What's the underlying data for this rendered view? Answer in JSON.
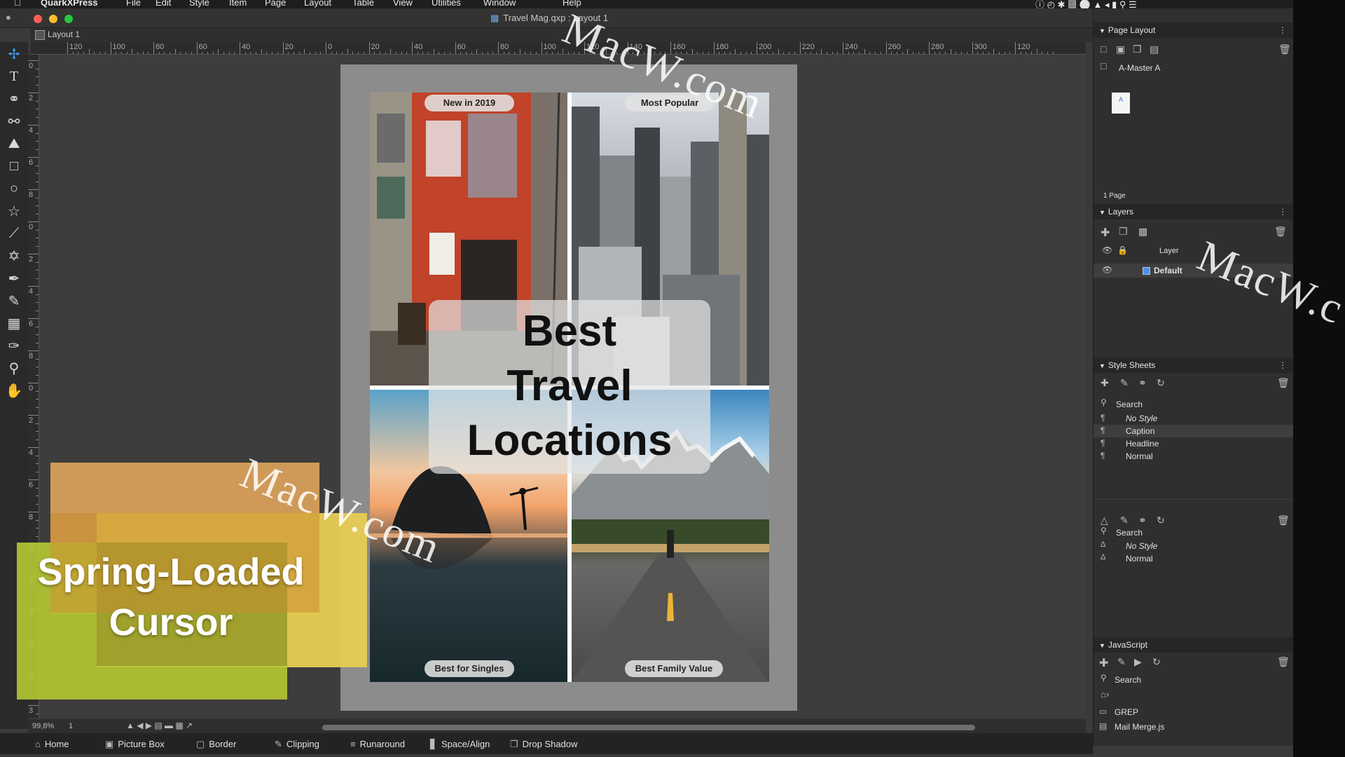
{
  "menubar": {
    "apple_icon": "apple-icon",
    "app_name": "QuarkXPress",
    "items": [
      "File",
      "Edit",
      "Style",
      "Item",
      "Page",
      "Layout",
      "Table",
      "View",
      "Utilities",
      "Window",
      "Help"
    ]
  },
  "window": {
    "title": "Travel Mag.qxp : Layout 1",
    "tab": "Layout 1"
  },
  "rulers": {
    "h": [
      "120",
      "100",
      "80",
      "60",
      "40",
      "20",
      "0",
      "20",
      "40",
      "60",
      "80",
      "100",
      "120",
      "140",
      "160",
      "180",
      "200",
      "220",
      "240",
      "260",
      "280",
      "300",
      "120"
    ],
    "v": [
      "0",
      "2",
      "4",
      "6",
      "8",
      "0",
      "2",
      "4",
      "6",
      "8",
      "0",
      "2",
      "4",
      "6",
      "8",
      "0",
      "2",
      "4",
      "6",
      "8",
      "3"
    ]
  },
  "tools": [
    "move-icon",
    "text-icon",
    "link-icon",
    "unlink-icon",
    "picture-icon",
    "rectangle-icon",
    "oval-icon",
    "star-icon",
    "line-icon",
    "bezier-icon",
    "pen-icon",
    "pencil-icon",
    "table-icon",
    "eyedropper-icon",
    "zoom-icon",
    "hand-icon"
  ],
  "layout": {
    "labels": {
      "top_left": "New in 2019",
      "top_right": "Most Popular",
      "bottom_left": "Best for Singles",
      "bottom_right": "Best Family Value"
    },
    "headline": [
      "Best",
      "Travel",
      "Locations"
    ]
  },
  "status": {
    "zoom": "99,8%",
    "page": "1"
  },
  "bottom_tabs": [
    {
      "label": "Home",
      "icon": "home-icon"
    },
    {
      "label": "Picture Box",
      "icon": "picture-box-icon"
    },
    {
      "label": "Border",
      "icon": "border-icon"
    },
    {
      "label": "Clipping",
      "icon": "clipping-icon"
    },
    {
      "label": "Runaround",
      "icon": "runaround-icon"
    },
    {
      "label": "Space/Align",
      "icon": "space-align-icon"
    },
    {
      "label": "Drop Shadow",
      "icon": "drop-shadow-icon"
    }
  ],
  "panels": {
    "page_layout": {
      "title": "Page Layout",
      "master": "A-Master A",
      "thumb_label": "A",
      "page_count": "1 Page"
    },
    "layers": {
      "title": "Layers",
      "col_header": "Layer",
      "items": [
        "Default"
      ]
    },
    "style_sheets": {
      "title": "Style Sheets",
      "search": "Search",
      "paragraph": [
        "No Style",
        "Caption",
        "Headline",
        "Normal"
      ],
      "char_search": "Search",
      "character": [
        "No Style",
        "Normal"
      ]
    },
    "javascript": {
      "title": "JavaScript",
      "search": "Search",
      "items": [
        "GREP",
        "Mail Merge.js"
      ]
    }
  },
  "overlay": {
    "lines": [
      "Spring-Loaded",
      "Cursor"
    ]
  },
  "watermarks": [
    "MacW.com",
    "MacW.com",
    "MacW.c"
  ],
  "colors": {
    "accent": "#3b9cf5",
    "overlay_green": "#b5c832",
    "overlay_yellow": "#e8cc52",
    "overlay_orange": "#dba25a"
  }
}
